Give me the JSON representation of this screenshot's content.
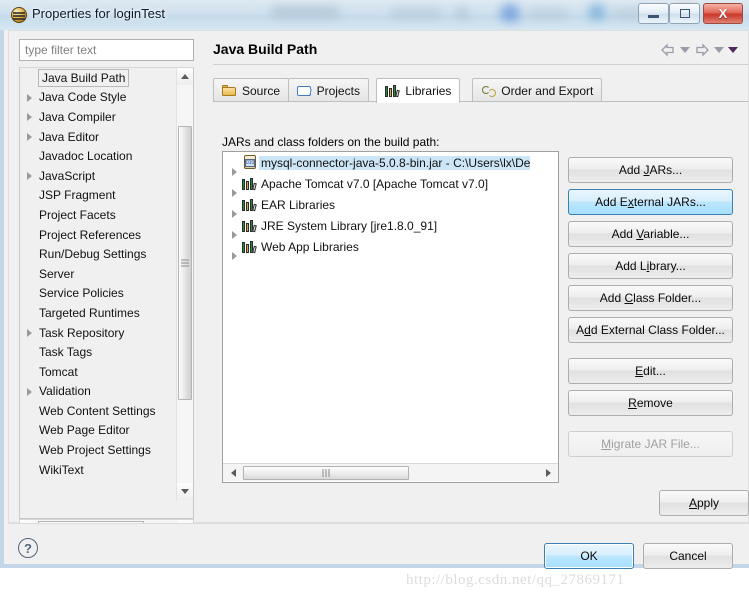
{
  "window": {
    "title": "Properties for loginTest",
    "app_icon": "eclipse-icon",
    "minimize_label": "–",
    "maximize_label": "□",
    "close_label": "X"
  },
  "sidebar": {
    "filter_placeholder": "type filter text",
    "items": [
      {
        "label": "Java Build Path",
        "expandable": false,
        "selected": true
      },
      {
        "label": "Java Code Style",
        "expandable": true,
        "selected": false
      },
      {
        "label": "Java Compiler",
        "expandable": true,
        "selected": false
      },
      {
        "label": "Java Editor",
        "expandable": true,
        "selected": false
      },
      {
        "label": "Javadoc Location",
        "expandable": false,
        "selected": false
      },
      {
        "label": "JavaScript",
        "expandable": true,
        "selected": false
      },
      {
        "label": "JSP Fragment",
        "expandable": false,
        "selected": false
      },
      {
        "label": "Project Facets",
        "expandable": false,
        "selected": false
      },
      {
        "label": "Project References",
        "expandable": false,
        "selected": false
      },
      {
        "label": "Run/Debug Settings",
        "expandable": false,
        "selected": false
      },
      {
        "label": "Server",
        "expandable": false,
        "selected": false
      },
      {
        "label": "Service Policies",
        "expandable": false,
        "selected": false
      },
      {
        "label": "Targeted Runtimes",
        "expandable": false,
        "selected": false
      },
      {
        "label": "Task Repository",
        "expandable": true,
        "selected": false
      },
      {
        "label": "Task Tags",
        "expandable": false,
        "selected": false
      },
      {
        "label": "Tomcat",
        "expandable": false,
        "selected": false
      },
      {
        "label": "Validation",
        "expandable": true,
        "selected": false
      },
      {
        "label": "Web Content Settings",
        "expandable": false,
        "selected": false
      },
      {
        "label": "Web Page Editor",
        "expandable": false,
        "selected": false
      },
      {
        "label": "Web Project Settings",
        "expandable": false,
        "selected": false
      },
      {
        "label": "WikiText",
        "expandable": false,
        "selected": false
      }
    ]
  },
  "page": {
    "title": "Java Build Path",
    "nav_back_icon": "back-arrow-icon",
    "nav_forward_icon": "forward-arrow-icon",
    "nav_menu_icon": "chevron-down-icon"
  },
  "tabs": [
    {
      "label": "Source",
      "icon": "source-folder-icon",
      "active": false
    },
    {
      "label": "Projects",
      "icon": "open-folder-icon",
      "active": false
    },
    {
      "label": "Libraries",
      "icon": "books-icon",
      "active": true
    },
    {
      "label": "Order and Export",
      "icon": "order-arrows-icon",
      "active": false
    }
  ],
  "libraries": {
    "label": "JARs and class folders on the build path:",
    "rows": [
      {
        "label": "mysql-connector-java-5.0.8-bin.jar - C:\\Users\\lx\\De",
        "icon": "jar-icon",
        "selected": true
      },
      {
        "label": "Apache Tomcat v7.0 [Apache Tomcat v7.0]",
        "icon": "books-icon",
        "selected": false
      },
      {
        "label": "EAR Libraries",
        "icon": "books-icon",
        "selected": false
      },
      {
        "label": "JRE System Library [jre1.8.0_91]",
        "icon": "books-icon",
        "selected": false
      },
      {
        "label": "Web App Libraries",
        "icon": "books-icon",
        "selected": false
      }
    ]
  },
  "actions": [
    {
      "label": "Add JARs...",
      "state": "normal",
      "mnemonic": "J"
    },
    {
      "label": "Add External JARs...",
      "state": "focused",
      "mnemonic": "x"
    },
    {
      "label": "Add Variable...",
      "state": "normal",
      "mnemonic": "V"
    },
    {
      "label": "Add Library...",
      "state": "normal",
      "mnemonic": "i"
    },
    {
      "label": "Add Class Folder...",
      "state": "normal",
      "mnemonic": "C"
    },
    {
      "label": "Add External Class Folder...",
      "state": "normal",
      "mnemonic": "d"
    },
    {
      "label": "Edit...",
      "state": "normal",
      "mnemonic": "E"
    },
    {
      "label": "Remove",
      "state": "normal",
      "mnemonic": "R"
    },
    {
      "label": "Migrate JAR File...",
      "state": "disabled",
      "mnemonic": "M"
    }
  ],
  "footer": {
    "apply_label": "Apply",
    "ok_label": "OK",
    "cancel_label": "Cancel",
    "help_icon": "question-mark-icon",
    "help_glyph": "?"
  },
  "watermark": "http://blog.csdn.net/qq_27869171",
  "colors": {
    "selection": "#cde6f7",
    "focus_border": "#3c7fb1",
    "title_text": "#0c1a2b",
    "close_button": "#c9372a"
  }
}
